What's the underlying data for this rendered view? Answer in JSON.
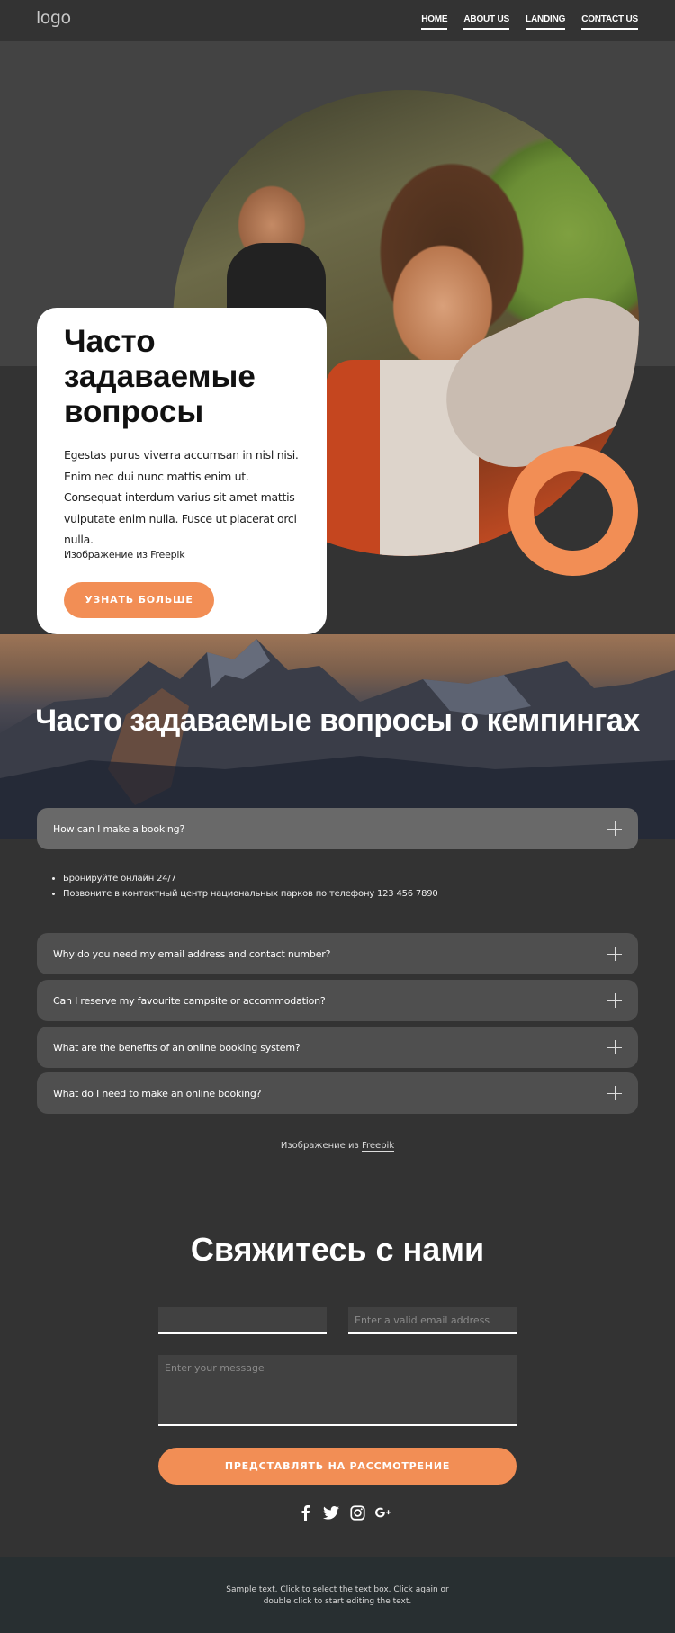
{
  "header": {
    "logo": "logo",
    "nav": [
      {
        "label": "HOME"
      },
      {
        "label": "ABOUT US"
      },
      {
        "label": "LANDING"
      },
      {
        "label": "CONTACT US"
      }
    ]
  },
  "hero": {
    "title": "Часто задаваемые вопросы",
    "body": "Egestas purus viverra accumsan in nisl nisi. Enim nec dui nunc mattis enim ut. Consequat interdum varius sit amet mattis vulputate enim nulla. Fusce ut placerat orci nulla.",
    "credit_prefix": "Изображение из ",
    "credit_link": "Freepik",
    "button": "УЗНАТЬ БОЛЬШЕ",
    "image_alt": "camping-selfie-photo"
  },
  "faq": {
    "title": "Часто задаваемые вопросы о кемпингах",
    "items": [
      {
        "question": "How can I make a booking?",
        "open": true
      },
      {
        "question": "Why do you need my email address and contact number?",
        "open": false
      },
      {
        "question": "Can I reserve my favourite campsite or accommodation?",
        "open": false
      },
      {
        "question": "What are the benefits of an online booking system?",
        "open": false
      },
      {
        "question": "What do I need to make an online booking?",
        "open": false
      }
    ],
    "answer": [
      "Бронируйте онлайн 24/7",
      "Позвоните в контактный центр национальных парков по телефону 123 456 7890"
    ],
    "credit_prefix": "Изображение из ",
    "credit_link": "Freepik"
  },
  "contact": {
    "title": "Свяжитесь с нами",
    "name_value": "",
    "name_placeholder": "",
    "email_placeholder": "Enter a valid email address",
    "message_placeholder": "Enter your message",
    "submit": "ПРЕДСТАВЛЯТЬ НА РАССМОТРЕНИЕ",
    "social": [
      {
        "name": "facebook",
        "glyph": "f"
      },
      {
        "name": "twitter",
        "glyph": "🐦"
      },
      {
        "name": "instagram",
        "glyph": "◎"
      },
      {
        "name": "google-plus",
        "glyph": "G+"
      }
    ]
  },
  "footer": {
    "text": "Sample text. Click to select the text box. Click again or double click to start editing the text."
  },
  "colors": {
    "accent": "#f28e55",
    "background": "#333333",
    "hero_top": "#434343",
    "faq_item": "#4f4f4f",
    "faq_item_open": "#696969",
    "footer": "#282f31"
  }
}
